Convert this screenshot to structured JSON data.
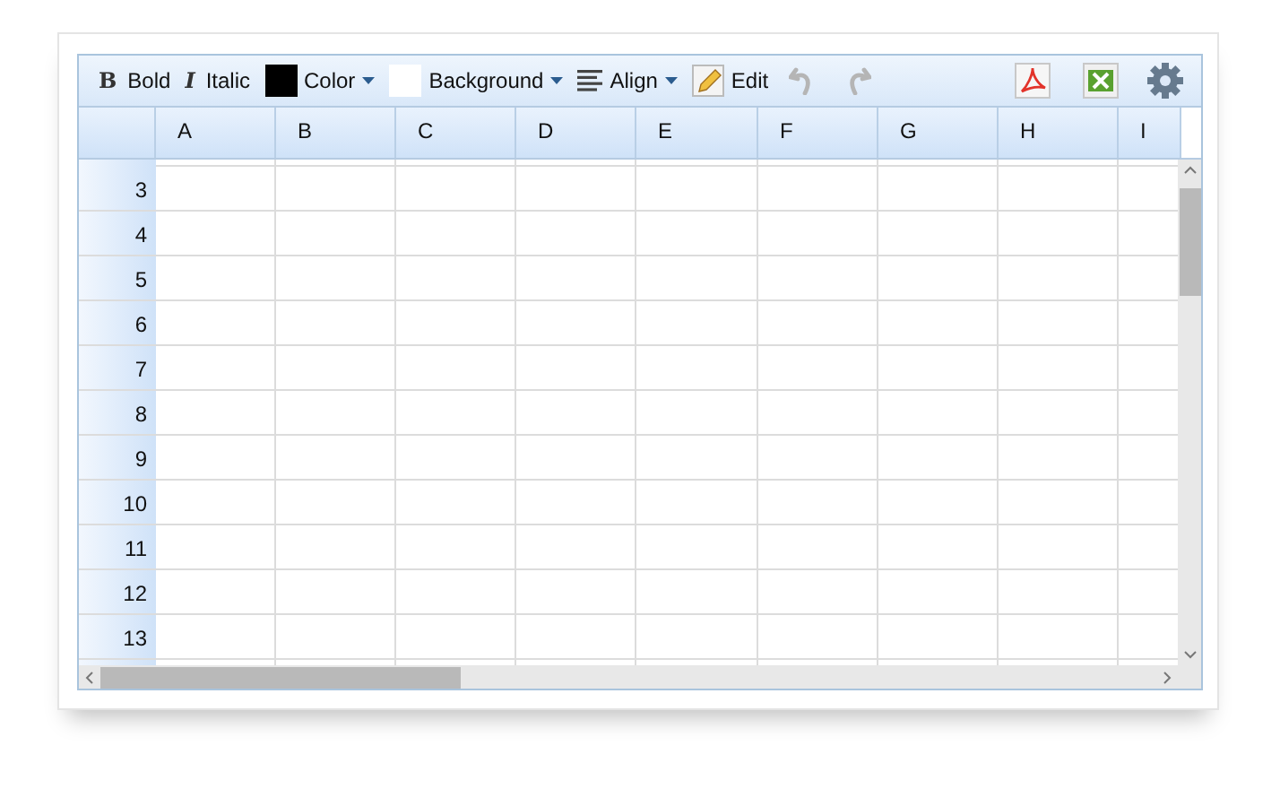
{
  "toolbar": [
    {
      "kind": "bold",
      "icon": "B",
      "label": "Bold"
    },
    {
      "kind": "italic",
      "icon": "I",
      "label": "Italic"
    },
    {
      "kind": "color",
      "label": "Color",
      "color": "#000000"
    },
    {
      "kind": "color",
      "label": "Background",
      "color": "#ffffff"
    },
    {
      "kind": "align",
      "label": "Align"
    },
    {
      "kind": "edit",
      "label": "Edit"
    },
    {
      "kind": "undo",
      "disabled": true
    },
    {
      "kind": "redo",
      "disabled": true
    }
  ],
  "toolbar_right": [
    {
      "kind": "pdf"
    },
    {
      "kind": "excel"
    },
    {
      "kind": "settings"
    }
  ],
  "columns": [
    "A",
    "B",
    "C",
    "D",
    "E",
    "F",
    "G",
    "H",
    "I"
  ],
  "rows": [
    "3",
    "4",
    "5",
    "6",
    "7",
    "8",
    "9",
    "10",
    "11",
    "12",
    "13"
  ]
}
